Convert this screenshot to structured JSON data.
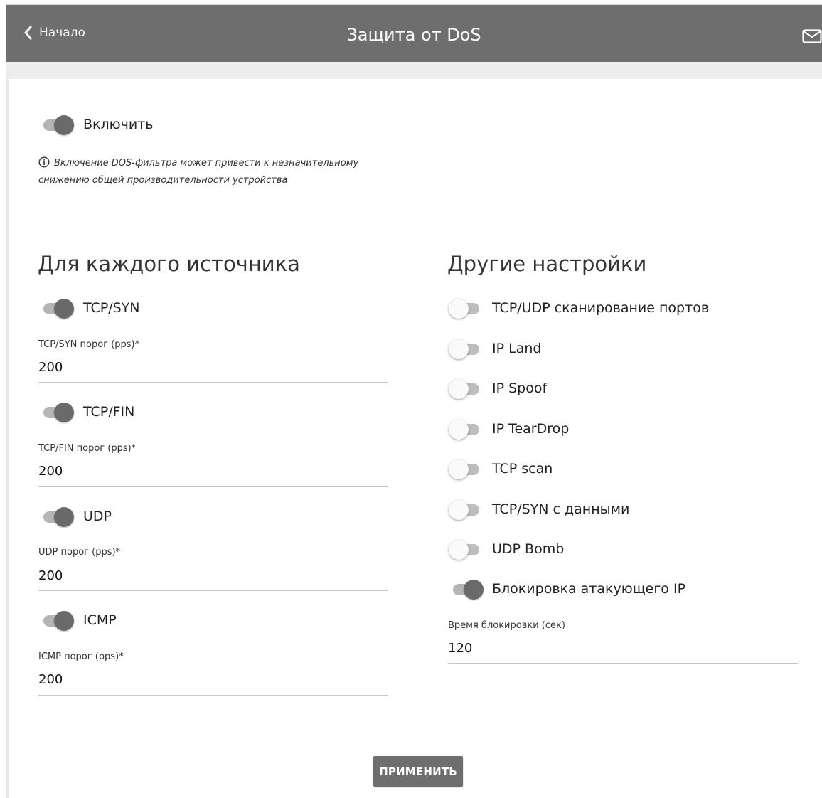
{
  "header": {
    "back_label": "Начало",
    "title": "Защита от DoS"
  },
  "enable": {
    "label": "Включить",
    "on": true,
    "info": "Включение DOS-фильтра может привести к незначительному снижению общей производительности устройства"
  },
  "per_source": {
    "title": "Для каждого источника",
    "items": [
      {
        "label": "TCP/SYN",
        "on": true,
        "field_label": "TCP/SYN порог (pps)*",
        "value": "200"
      },
      {
        "label": "TCP/FIN",
        "on": true,
        "field_label": "TCP/FIN порог (pps)*",
        "value": "200"
      },
      {
        "label": "UDP",
        "on": true,
        "field_label": "UDP порог (pps)*",
        "value": "200"
      },
      {
        "label": "ICMP",
        "on": true,
        "field_label": "ICMP порог (pps)*",
        "value": "200"
      }
    ]
  },
  "other": {
    "title": "Другие настройки",
    "items": [
      {
        "label": "TCP/UDP сканирование портов",
        "on": false
      },
      {
        "label": "IP Land",
        "on": false
      },
      {
        "label": "IP Spoof",
        "on": false
      },
      {
        "label": "IP TearDrop",
        "on": false
      },
      {
        "label": "TCP scan",
        "on": false
      },
      {
        "label": "TCP/SYN с данными",
        "on": false
      },
      {
        "label": "UDP Bomb",
        "on": false
      },
      {
        "label": "Блокировка атакующего IP",
        "on": true
      }
    ],
    "block_time_label": "Время блокировки (сек)",
    "block_time_value": "120"
  },
  "apply_label": "ПРИМЕНИТЬ",
  "colors": {
    "header_bg": "#6e6e6e",
    "toggle_on": "#6a6a6a",
    "toggle_track": "#b5b5b5",
    "button_bg": "#6e6e6e"
  }
}
